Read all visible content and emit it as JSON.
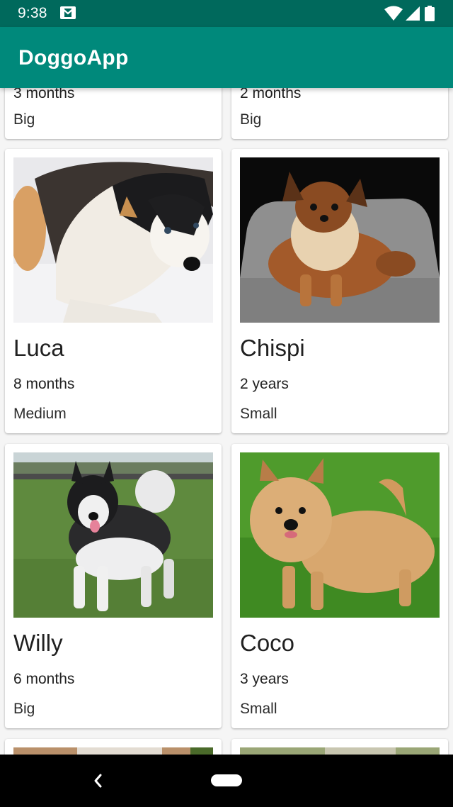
{
  "status_bar": {
    "time": "9:38",
    "icons": [
      "mail-icon",
      "wifi-icon",
      "signal-icon",
      "battery-icon"
    ]
  },
  "app_bar": {
    "title": "DoggoApp",
    "color": "#00897b"
  },
  "dogs": [
    {
      "age": "3 months",
      "size": "Big"
    },
    {
      "age": "2 months",
      "size": "Big"
    },
    {
      "name": "Luca",
      "age": "8 months",
      "size": "Medium"
    },
    {
      "name": "Chispi",
      "age": "2 years",
      "size": "Small"
    },
    {
      "name": "Willy",
      "age": "6 months",
      "size": "Big"
    },
    {
      "name": "Coco",
      "age": "3 years",
      "size": "Small"
    }
  ],
  "nav_bar": {
    "icons": [
      "back-icon",
      "home-pill-icon"
    ]
  }
}
